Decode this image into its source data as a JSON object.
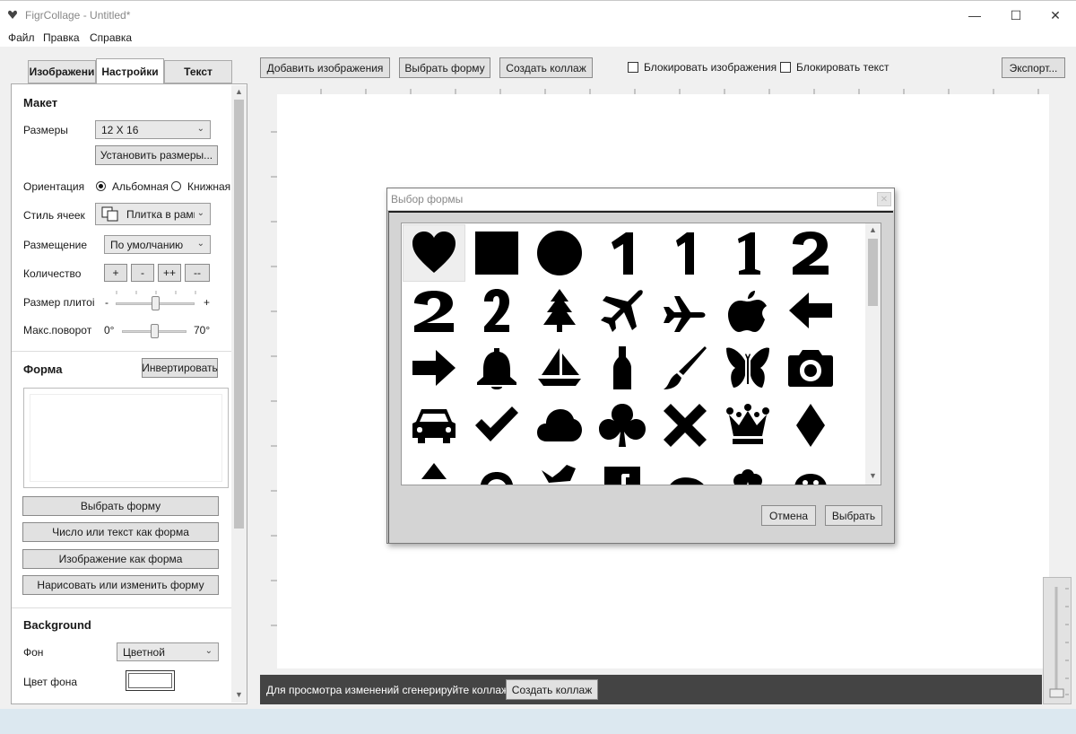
{
  "window": {
    "title": "FigrCollage - Untitled*",
    "minimize": "—",
    "maximize": "☐",
    "close": "✕"
  },
  "menu": {
    "file": "Файл",
    "edit": "Правка",
    "help": "Справка"
  },
  "tabs": {
    "images": "Изображени",
    "settings": "Настройки",
    "text": "Текст"
  },
  "toolbar": {
    "add_images": "Добавить изображения",
    "choose_shape": "Выбрать форму",
    "create_collage": "Создать коллаж",
    "lock_images": "Блокировать изображения",
    "lock_text": "Блокировать текст",
    "export": "Экспорт..."
  },
  "layout": {
    "title": "Макет",
    "size_label": "Размеры",
    "size_value": "12 X 16",
    "set_size_button": "Установить размеры...",
    "orientation_label": "Ориентация",
    "landscape": "Альбомная",
    "portrait": "Книжная",
    "cell_style_label": "Стиль ячеек",
    "cell_style_value": "Плитка в рамке",
    "placement_label": "Размещение",
    "placement_value": "По умолчанию",
    "count_label": "Количество",
    "count_buttons": [
      "+",
      "-",
      "++",
      "--"
    ],
    "tile_size_label": "Размер плитоі",
    "tile_size_min": "-",
    "tile_size_max": "+",
    "tile_size_level": 0.5,
    "max_rotation_label": "Макс.поворот",
    "max_rotation_min": "0°",
    "max_rotation_max": "70°",
    "max_rotation_level": 0.5
  },
  "shape": {
    "title": "Форма",
    "invert_button": "Инвертировать",
    "choose_button": "Выбрать форму",
    "number_text_button": "Число или текст как форма",
    "image_button": "Изображение как форма",
    "draw_button": "Нарисовать или изменить форму"
  },
  "background": {
    "title": "Background",
    "fill_label": "Фон",
    "fill_value": "Цветной",
    "color_label": "Цвет фона",
    "color_value": "#ffffff"
  },
  "status": {
    "message": "Для просмотра изменений сгенерируйте коллаж",
    "create_collage": "Создать коллаж"
  },
  "dialog": {
    "title": "Выбор формы",
    "close": "✕",
    "cancel": "Отмена",
    "select": "Выбрать",
    "shapes": [
      "heart",
      "square",
      "circle",
      "one-sans",
      "one-condensed",
      "one-serif",
      "two-sans",
      "two-serif",
      "two-condensed",
      "tree",
      "airplane",
      "airplane-side",
      "apple",
      "arrow-left",
      "arrow-right",
      "bell",
      "sailboat",
      "bottle",
      "paintbrush",
      "butterfly",
      "camera",
      "car",
      "checkmark",
      "cloud",
      "club",
      "cross",
      "crown",
      "diamond"
    ],
    "selected": "heart"
  },
  "colors": {
    "accent": "#444444",
    "panel": "#ffffff",
    "chrome": "#f0f0f0"
  }
}
